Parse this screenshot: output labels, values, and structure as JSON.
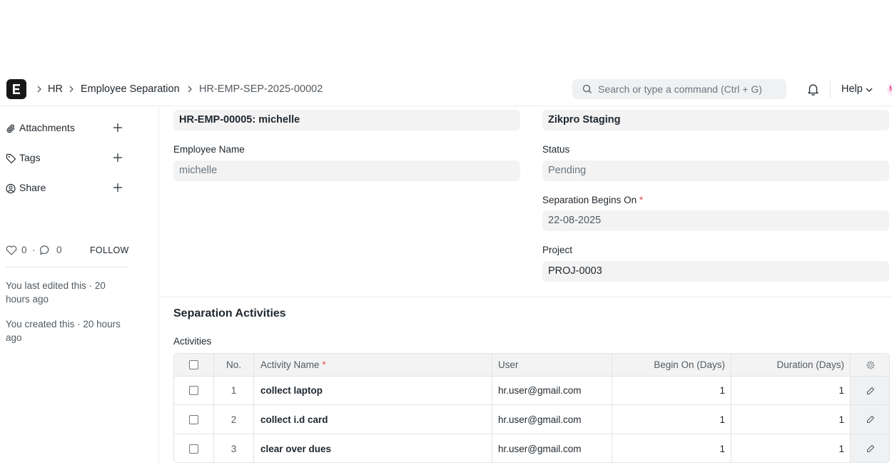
{
  "breadcrumbs": [
    "HR",
    "Employee Separation",
    "HR-EMP-SEP-2025-00002"
  ],
  "search": {
    "placeholder": "Search or type a command (Ctrl + G)"
  },
  "navbar": {
    "help_label": "Help",
    "avatar_initial": "M"
  },
  "sidebar": {
    "items": [
      {
        "label": "Attachments",
        "icon": "paperclip-icon"
      },
      {
        "label": "Tags",
        "icon": "tag-icon"
      },
      {
        "label": "Share",
        "icon": "user-share-icon"
      }
    ],
    "likes": "0",
    "comments": "0",
    "follow_label": "FOLLOW",
    "last_edited": "You last edited this · 20 hours ago",
    "created": "You created this · 20 hours ago"
  },
  "form": {
    "employee": "HR-EMP-00005: michelle",
    "company": "Zikpro Staging",
    "employee_name_label": "Employee Name",
    "employee_name": "michelle",
    "status_label": "Status",
    "status": "Pending",
    "separation_begins_label": "Separation Begins On",
    "separation_begins": "22-08-2025",
    "project_label": "Project",
    "project": "PROJ-0003",
    "required_mark": "*"
  },
  "section": {
    "title": "Separation Activities",
    "grid_label": "Activities"
  },
  "table": {
    "headers": {
      "no": "No.",
      "activity": "Activity Name",
      "user": "User",
      "begin": "Begin On (Days)",
      "duration": "Duration (Days)"
    },
    "rows": [
      {
        "no": "1",
        "activity": "collect laptop",
        "user": "hr.user@gmail.com",
        "begin": "1",
        "duration": "1"
      },
      {
        "no": "2",
        "activity": "collect i.d card",
        "user": "hr.user@gmail.com",
        "begin": "1",
        "duration": "1"
      },
      {
        "no": "3",
        "activity": "clear over dues",
        "user": "hr.user@gmail.com",
        "begin": "1",
        "duration": "1"
      }
    ]
  }
}
